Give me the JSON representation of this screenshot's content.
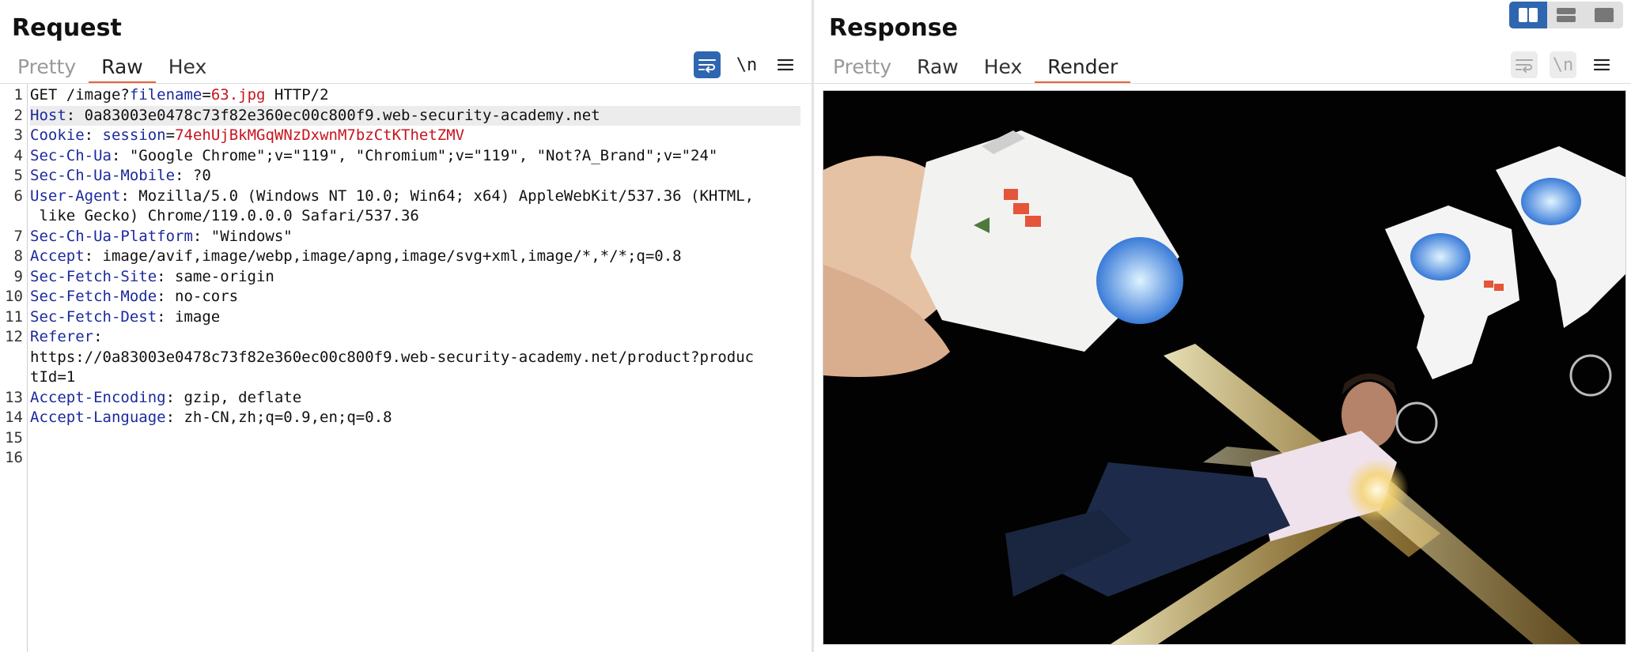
{
  "request": {
    "title": "Request",
    "tabs": [
      {
        "label": "Pretty",
        "state": "inactive"
      },
      {
        "label": "Raw",
        "state": "active"
      },
      {
        "label": "Hex",
        "state": "inactive"
      }
    ],
    "tools": {
      "wrap_icon": "word-wrap-icon",
      "newline_label": "\\n",
      "menu_icon": "hamburger-menu-icon"
    },
    "lines": [
      {
        "n": "1",
        "parts": [
          [
            "v",
            "GET /image?"
          ],
          [
            "k",
            "filename"
          ],
          [
            "v",
            "="
          ],
          [
            "r",
            "63.jpg"
          ],
          [
            "v",
            " HTTP/2"
          ]
        ]
      },
      {
        "n": "2",
        "hl": true,
        "parts": [
          [
            "k",
            "Host"
          ],
          [
            "v",
            ": 0a83003e0478c73f82e360ec00c800f9.web-security-academy.net"
          ]
        ]
      },
      {
        "n": "3",
        "parts": [
          [
            "k",
            "Cookie"
          ],
          [
            "v",
            ": "
          ],
          [
            "k",
            "session"
          ],
          [
            "v",
            "="
          ],
          [
            "r",
            "74ehUjBkMGqWNzDxwnM7bzCtKThetZMV"
          ]
        ]
      },
      {
        "n": "4",
        "parts": [
          [
            "k",
            "Sec-Ch-Ua"
          ],
          [
            "v",
            ": \"Google Chrome\";v=\"119\", \"Chromium\";v=\"119\", \"Not?A_Brand\";v=\"24\""
          ]
        ]
      },
      {
        "n": "5",
        "parts": [
          [
            "k",
            "Sec-Ch-Ua-Mobile"
          ],
          [
            "v",
            ": ?0"
          ]
        ]
      },
      {
        "n": "6",
        "parts": [
          [
            "k",
            "User-Agent"
          ],
          [
            "v",
            ": Mozilla/5.0 (Windows NT 10.0; Win64; x64) AppleWebKit/537.36 (KHTML,"
          ]
        ]
      },
      {
        "n": "",
        "parts": [
          [
            "v",
            " like Gecko) Chrome/119.0.0.0 Safari/537.36"
          ]
        ]
      },
      {
        "n": "7",
        "parts": [
          [
            "k",
            "Sec-Ch-Ua-Platform"
          ],
          [
            "v",
            ": \"Windows\""
          ]
        ]
      },
      {
        "n": "8",
        "parts": [
          [
            "k",
            "Accept"
          ],
          [
            "v",
            ": image/avif,image/webp,image/apng,image/svg+xml,image/*,*/*;q=0.8"
          ]
        ]
      },
      {
        "n": "9",
        "parts": [
          [
            "k",
            "Sec-Fetch-Site"
          ],
          [
            "v",
            ": same-origin"
          ]
        ]
      },
      {
        "n": "10",
        "parts": [
          [
            "k",
            "Sec-Fetch-Mode"
          ],
          [
            "v",
            ": no-cors"
          ]
        ]
      },
      {
        "n": "11",
        "parts": [
          [
            "k",
            "Sec-Fetch-Dest"
          ],
          [
            "v",
            ": image"
          ]
        ]
      },
      {
        "n": "12",
        "parts": [
          [
            "k",
            "Referer"
          ],
          [
            "v",
            ":"
          ]
        ]
      },
      {
        "n": "",
        "parts": [
          [
            "v",
            "https://0a83003e0478c73f82e360ec00c800f9.web-security-academy.net/product?produc"
          ]
        ]
      },
      {
        "n": "",
        "parts": [
          [
            "v",
            "tId=1"
          ]
        ]
      },
      {
        "n": "13",
        "parts": [
          [
            "k",
            "Accept-Encoding"
          ],
          [
            "v",
            ": gzip, deflate"
          ]
        ]
      },
      {
        "n": "14",
        "parts": [
          [
            "k",
            "Accept-Language"
          ],
          [
            "v",
            ": zh-CN,zh;q=0.9,en;q=0.8"
          ]
        ]
      },
      {
        "n": "15",
        "parts": []
      },
      {
        "n": "16",
        "parts": []
      }
    ]
  },
  "response": {
    "title": "Response",
    "tabs": [
      {
        "label": "Pretty",
        "state": "inactive"
      },
      {
        "label": "Raw",
        "state": "inactive"
      },
      {
        "label": "Hex",
        "state": "inactive"
      },
      {
        "label": "Render",
        "state": "active"
      }
    ],
    "tools": {
      "wrap_icon": "word-wrap-icon",
      "newline_label": "\\n",
      "menu_icon": "hamburger-menu-icon"
    },
    "layout_buttons": [
      "split-vertical-icon",
      "split-horizontal-icon",
      "single-pane-icon"
    ],
    "render": {
      "image": "laser-tag-guns-product-image"
    }
  },
  "colors": {
    "accent": "#e8643a",
    "brand_blue": "#2f66b0",
    "header_key": "#1b2a9c",
    "value_red": "#c8141e"
  }
}
